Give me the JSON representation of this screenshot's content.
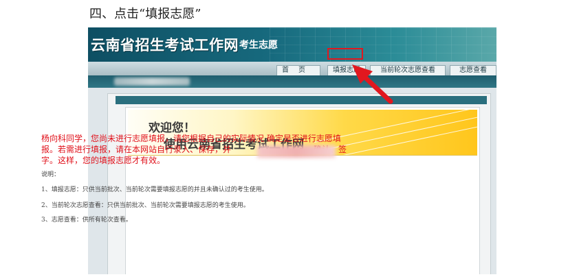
{
  "step_heading": "四、点击“填报志愿”",
  "site": {
    "title": "云南省招生考试工作网",
    "subtitle": "考生志愿"
  },
  "nav": {
    "items": [
      {
        "label": "首页"
      },
      {
        "label": "填报志愿"
      },
      {
        "label": "当前轮次志愿查看"
      },
      {
        "label": "志愿查看"
      }
    ],
    "highlight_color": "#e1181f"
  },
  "welcome": {
    "line1": "欢迎您！",
    "line2": "使用云南省招生考试工作网"
  },
  "notice": {
    "line1": "杨向科同学，您尚未进行志愿填报，请您根据自己的实际情况 确定是否进行志愿填",
    "line2": "报。若需进行填报，请在本网站自行录入、保存，并",
    "line2_tail": "确认、签",
    "line3": "字。这样，您的填报志愿才有效。",
    "color": "#e0101a"
  },
  "description": {
    "title": "说明：",
    "items": [
      "1、填报志愿：只供当前批次、当前轮次需要填报志愿的并且未确认过的考生使用。",
      "2、当前轮次志愿查看：只供当前批次、当前轮次需要填报志愿的考生使用。",
      "3、志愿查看：供所有轮次查看。"
    ]
  },
  "colors": {
    "banner": "#176a7e",
    "arrow": "#e1181f"
  }
}
